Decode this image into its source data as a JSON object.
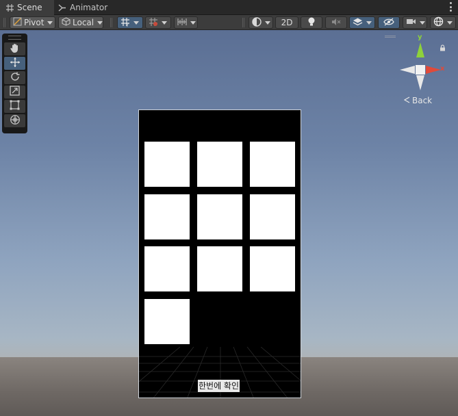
{
  "tabs": [
    {
      "label": "Scene",
      "icon": "grid-icon",
      "active": true
    },
    {
      "label": "Animator",
      "icon": "animator-icon",
      "active": false
    }
  ],
  "toolbar": {
    "pivot_label": "Pivot",
    "space_label": "Local",
    "mode_2d_label": "2D"
  },
  "scene": {
    "gizmo": {
      "y_label": "y",
      "x_label": "x",
      "back_label": "Back"
    },
    "canvas": {
      "confirm_label": "한번에 확인",
      "cell_count": 10
    }
  },
  "colors": {
    "accent": "#46607c",
    "x_axis": "#e04a3a",
    "y_axis": "#8ed23a",
    "canvas_bg": "#000000",
    "cell": "#ffffff"
  }
}
